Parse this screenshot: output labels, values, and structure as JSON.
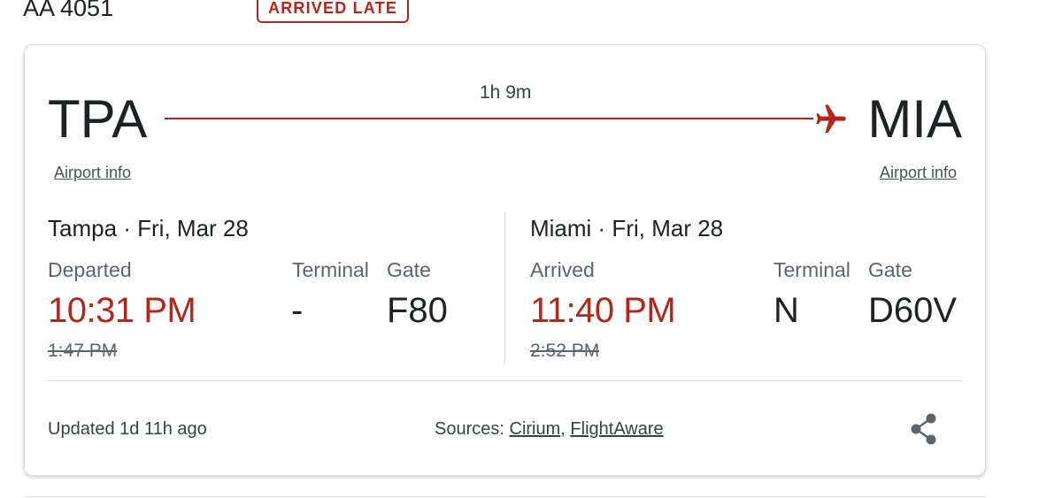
{
  "header": {
    "flight_number": "AA 4051",
    "status": "ARRIVED LATE"
  },
  "colors": {
    "accent_red": "#b3261e",
    "text_primary": "#202124",
    "text_secondary": "#5f6368",
    "divider": "#dadce0"
  },
  "route": {
    "duration": "1h 9m",
    "plane_icon": "airplane-icon",
    "origin": {
      "code": "TPA",
      "airport_info": "Airport info",
      "city_date": "Tampa · Fri, Mar 28",
      "time_label": "Departed",
      "terminal_label": "Terminal",
      "gate_label": "Gate",
      "actual_time": "10:31 PM",
      "scheduled_time": "1:47 PM",
      "terminal": "-",
      "gate": "F80"
    },
    "destination": {
      "code": "MIA",
      "airport_info": "Airport info",
      "city_date": "Miami · Fri, Mar 28",
      "time_label": "Arrived",
      "terminal_label": "Terminal",
      "gate_label": "Gate",
      "actual_time": "11:40 PM",
      "scheduled_time": "2:52 PM",
      "terminal": "N",
      "gate": "D60V"
    }
  },
  "footer": {
    "updated": "Updated 1d 11h ago",
    "sources_label": "Sources:",
    "source_1": "Cirium",
    "separator": ",",
    "source_2": "FlightAware",
    "share_icon": "share-icon"
  }
}
